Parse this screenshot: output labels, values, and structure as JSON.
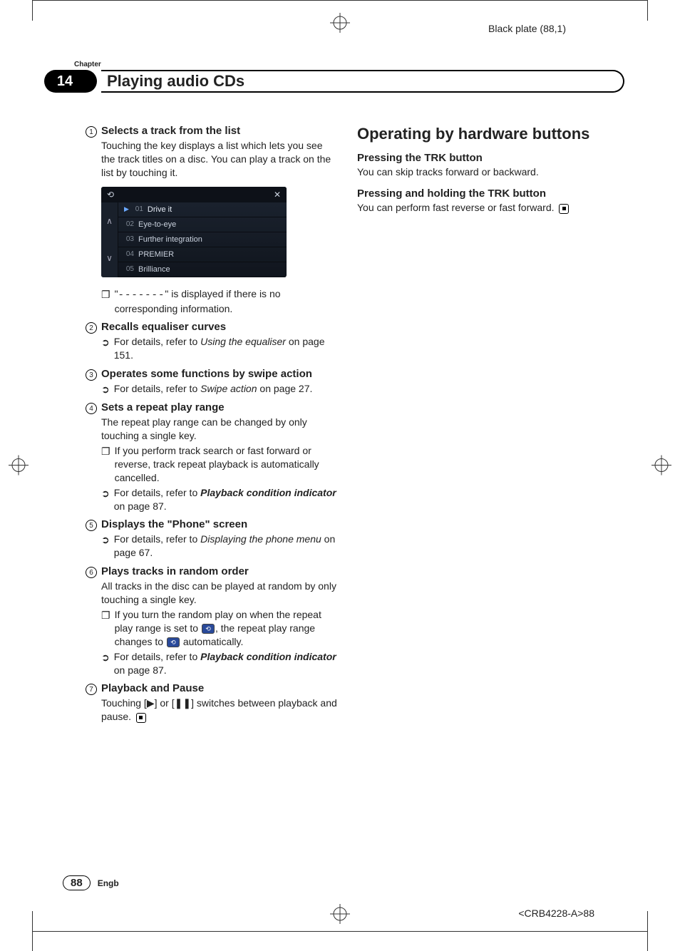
{
  "meta": {
    "black_plate": "Black plate (88,1)",
    "doc_code": "<CRB4228-A>88"
  },
  "header": {
    "chapter_label": "Chapter",
    "chapter_num": "14",
    "title": "Playing audio CDs"
  },
  "col1": {
    "i1": {
      "num": "1",
      "head": "Selects a track from the list",
      "body": "Touching the key displays a list which lets you see the track titles on a disc. You can play a track on the list by touching it."
    },
    "tracks": {
      "back": "⟲",
      "close": "✕",
      "r1": {
        "n": "01",
        "t": "Drive it"
      },
      "r2": {
        "n": "02",
        "t": "Eye-to-eye"
      },
      "r3": {
        "n": "03",
        "t": "Further integration"
      },
      "r4": {
        "n": "04",
        "t": "PREMIER"
      },
      "r5": {
        "n": "05",
        "t": "Brilliance"
      }
    },
    "i1_note_pre": "\"",
    "i1_note_dashes": "-------",
    "i1_note_post": "\" is displayed if there is no corresponding information.",
    "i2": {
      "num": "2",
      "head": "Recalls equaliser curves",
      "ref_pre": "For details, refer to ",
      "ref_link": "Using the equaliser",
      "ref_post": " on page 151."
    },
    "i3": {
      "num": "3",
      "head": "Operates some functions by swipe action",
      "ref_pre": "For details, refer to ",
      "ref_link": "Swipe action",
      "ref_post": " on page 27."
    },
    "i4": {
      "num": "4",
      "head": "Sets a repeat play range",
      "body": "The repeat play range can be changed by only touching a single key.",
      "n1": "If you perform track search or fast forward or reverse, track repeat playback is automatically cancelled.",
      "ref_pre": "For details, refer to ",
      "ref_link": "Playback condition indicator",
      "ref_post": " on page 87."
    },
    "i5": {
      "num": "5",
      "head": "Displays the \"Phone\" screen",
      "ref_pre": "For details, refer to ",
      "ref_link": "Displaying the phone menu",
      "ref_post": " on page 67."
    },
    "i6": {
      "num": "6",
      "head": "Plays tracks in random order",
      "body": "All tracks in the disc can be played at random by only touching a single key.",
      "n1_a": "If you turn the random play on when the repeat play range is set to ",
      "n1_b": ", the repeat play range changes to ",
      "n1_c": " automatically.",
      "ref_pre": "For details, refer to ",
      "ref_link": "Playback condition indicator",
      "ref_post": " on page 87."
    },
    "i7": {
      "num": "7",
      "head": "Playback and Pause",
      "body_a": "Touching [",
      "play": "▶",
      "body_b": "] or [",
      "pause": "❚❚",
      "body_c": "] switches between playback and pause."
    }
  },
  "col2": {
    "title": "Operating by hardware buttons",
    "h3a": "Pressing the TRK button",
    "p1": "You can skip tracks forward or backward.",
    "h3b": "Pressing and holding the TRK button",
    "p2": "You can perform fast reverse or fast forward."
  },
  "footer": {
    "page": "88",
    "lang": "Engb"
  }
}
